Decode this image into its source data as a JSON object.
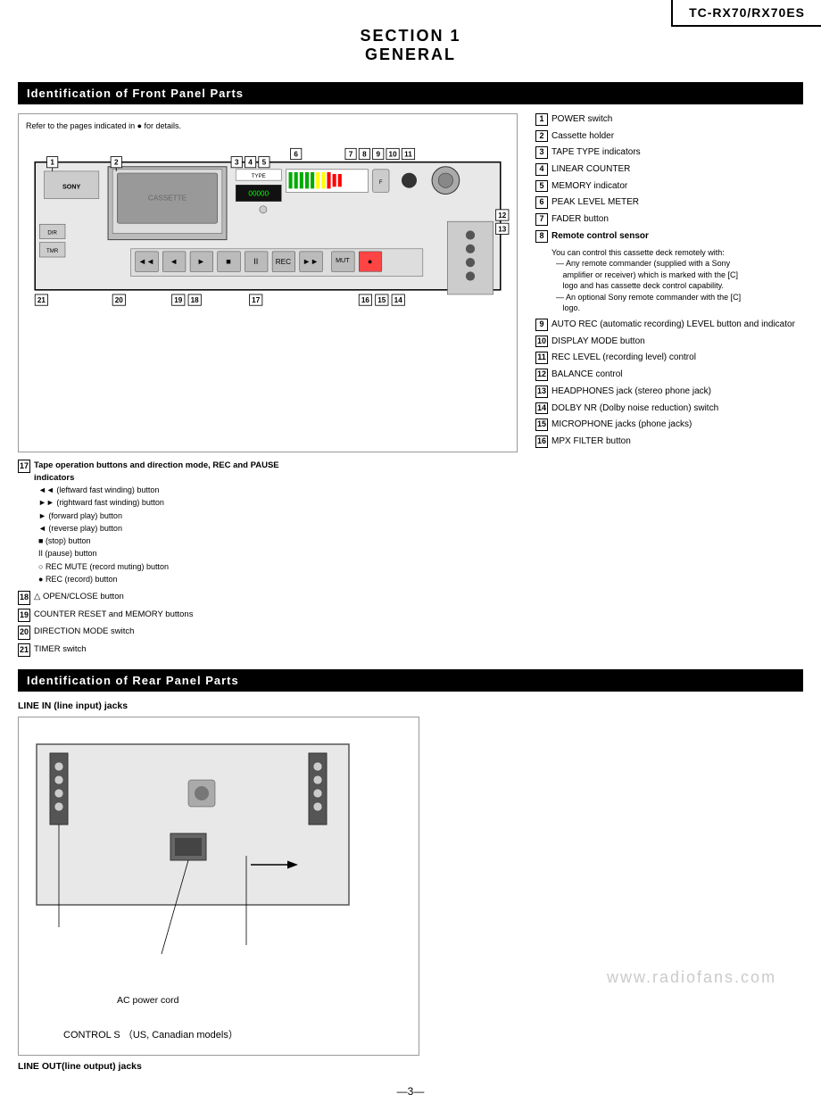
{
  "header": {
    "model": "TC-RX70/RX70ES"
  },
  "section": {
    "number": "SECTION 1",
    "title": "GENERAL"
  },
  "front_panel": {
    "bar_title": "Identification of Front Panel Parts",
    "diagram_note": "Refer to the pages indicated in ● for details.",
    "labels": [
      {
        "num": "1",
        "text": "POWER switch"
      },
      {
        "num": "2",
        "text": "Cassette holder"
      },
      {
        "num": "3",
        "text": "TAPE TYPE indicators"
      },
      {
        "num": "4",
        "text": "LINEAR COUNTER"
      },
      {
        "num": "5",
        "text": "MEMORY indicator"
      },
      {
        "num": "6",
        "text": "PEAK LEVEL METER"
      },
      {
        "num": "7",
        "text": "FADER button"
      },
      {
        "num": "8",
        "text": "Remote control sensor",
        "subtext": "You can control this cassette deck remotely with:\n— Any remote commander (supplied with a Sony\n   amplifier or receiver) which is marked with the [C]\n   logo and has cassette deck control capability.\n— An optional Sony remote commander with the [C]\n   logo."
      },
      {
        "num": "9",
        "text": "AUTO REC (automatic recording) LEVEL button and indicator"
      },
      {
        "num": "10",
        "text": "DISPLAY MODE button"
      },
      {
        "num": "11",
        "text": "REC LEVEL (recording level) control"
      },
      {
        "num": "12",
        "text": "BALANCE control"
      },
      {
        "num": "13",
        "text": "HEADPHONES jack (stereo phone jack)"
      },
      {
        "num": "14",
        "text": "DOLBY NR (Dolby noise reduction) switch"
      },
      {
        "num": "15",
        "text": "MICROPHONE jacks (phone jacks)"
      },
      {
        "num": "16",
        "text": "MPX FILTER button"
      }
    ],
    "bottom_notes": {
      "note17": {
        "num": "17",
        "title": "Tape operation buttons and direction mode, REC and PAUSE indicators",
        "items": [
          "◄◄ (leftward fast winding) button",
          "►► (rightward fast winding) button",
          "► (forward play) button",
          "◄ (reverse play) button",
          "■ (stop) button",
          "II (pause) button",
          "○ REC MUTE (record muting) button",
          "● REC (record) button"
        ]
      },
      "note18": {
        "num": "18",
        "text": "△ OPEN/CLOSE button"
      },
      "note19": {
        "num": "19",
        "text": "COUNTER RESET and MEMORY buttons"
      },
      "note20": {
        "num": "20",
        "text": "DIRECTION MODE switch"
      },
      "note21": {
        "num": "21",
        "text": "TIMER switch"
      }
    }
  },
  "rear_panel": {
    "bar_title": "Identification of Rear Panel Parts",
    "label_top": "LINE IN (line input) jacks",
    "label_bottom": "LINE OUT(line output) jacks",
    "label_ac": "AC power cord",
    "label_control_s": "CONTROL S  （US, Canadian models）"
  },
  "page_number": "—3—",
  "watermark": "www.radiofans.com"
}
